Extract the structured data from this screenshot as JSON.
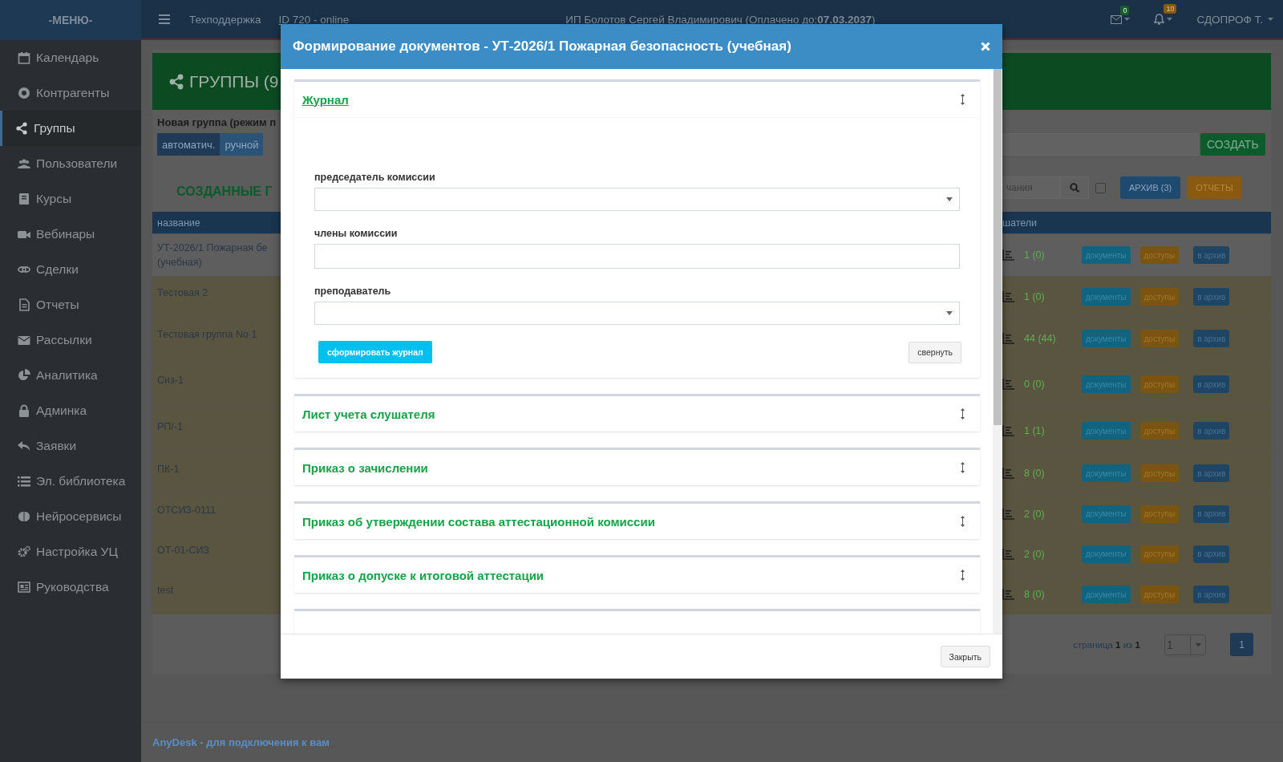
{
  "topbar": {
    "menu_title": "-МЕНЮ-",
    "support": "Техподдержка",
    "session": "ID 720 - online",
    "account": "ИП Болотов Сергей Владимирович (Оплачено до:**07.03.2037**)",
    "mail_count": "0",
    "notification_count": "10",
    "user": "СДОПРОФ Т."
  },
  "sidebar": {
    "items": [
      {
        "label": "Календарь",
        "selected": false
      },
      {
        "label": "Контрагенты",
        "selected": false
      },
      {
        "label": "Группы",
        "selected": true
      },
      {
        "label": "Пользователи",
        "selected": false
      },
      {
        "label": "Курсы",
        "selected": false
      },
      {
        "label": "Вебинары",
        "selected": false
      },
      {
        "label": "Сделки",
        "selected": false
      },
      {
        "label": "Отчеты",
        "selected": false
      },
      {
        "label": "Рассылки",
        "selected": false
      },
      {
        "label": "Аналитика",
        "selected": false
      },
      {
        "label": "Админка",
        "selected": false
      },
      {
        "label": "Заявки",
        "selected": false
      },
      {
        "label": "Эл. библиотека",
        "selected": false
      },
      {
        "label": "Нейросервисы",
        "selected": false
      },
      {
        "label": "Настройка УЦ",
        "selected": false
      },
      {
        "label": "Руководства",
        "selected": false
      }
    ]
  },
  "groups": {
    "title": "ГРУППЫ (9",
    "new_group_label": "Новая группа (режим п",
    "modes": [
      {
        "label": "автоматич.",
        "selected": true
      },
      {
        "label": "ручной",
        "selected": false
      }
    ],
    "create_button": "СОЗДАТЬ",
    "list_title": "СОЗДАННЫЕ Г",
    "search": {
      "placeholder": "чания"
    },
    "show_archived": {
      "checked": false
    },
    "archive_button": "АРХИВ (3)",
    "reports_button": "ОТЧЕТЫ",
    "table": {
      "columns": [
        "название",
        "шатели"
      ],
      "rows": [
        {
          "name": "УТ-2026/1 Пожарная бе",
          "name_continued": "(учебная)",
          "highlighted": false,
          "count": "1 (0)",
          "documents_button": "документы",
          "access_button": "доступы",
          "archive_button": "в архив"
        },
        {
          "name": "Тестовая 2",
          "highlighted": true,
          "count": "1 (0)",
          "documents_button": "документы",
          "access_button": "доступы",
          "archive_button": "в архив"
        },
        {
          "name": "Тестовая группа No 1",
          "highlighted": true,
          "count": "44 (44)",
          "documents_button": "документы",
          "access_button": "доступы",
          "archive_button": "в архив"
        },
        {
          "name": "Сиз-1",
          "highlighted": true,
          "count": "0 (0)",
          "documents_button": "документы",
          "access_button": "доступы",
          "archive_button": "в архив"
        },
        {
          "name": "РП/-1",
          "highlighted": true,
          "count": "1 (1)",
          "documents_button": "документы",
          "access_button": "доступы",
          "archive_button": "в архив"
        },
        {
          "name": "ПК-1",
          "highlighted": true,
          "count": "8 (0)",
          "documents_button": "документы",
          "access_button": "доступы",
          "archive_button": "в архив"
        },
        {
          "name": "ОТСИЗ-0111",
          "highlighted": true,
          "count": "2 (0)",
          "documents_button": "документы",
          "access_button": "доступы",
          "archive_button": "в архив"
        },
        {
          "name": "ОТ-01-СИЗ",
          "highlighted": true,
          "count": "2 (0)",
          "documents_button": "документы",
          "access_button": "доступы",
          "archive_button": "в архив"
        },
        {
          "name": "test",
          "highlighted": true,
          "count": "8 (0)",
          "documents_button": "документы",
          "access_button": "доступы",
          "archive_button": "в архив"
        }
      ]
    },
    "pagination": {
      "label": "страница **1** из **1**",
      "page_select": "1",
      "pages": [
        {
          "label": "1",
          "selected": true
        }
      ]
    }
  },
  "modal": {
    "title": "Формирование документов - УТ-2026/1 Пожарная безопасность (учебная)",
    "sections": [
      {
        "title": "Журнал",
        "expanded": true,
        "fields": [
          {
            "label": "председатель комиссии",
            "kind": "select"
          },
          {
            "label": "члены комиссии",
            "kind": "input"
          },
          {
            "label": "преподаватель",
            "kind": "select"
          }
        ],
        "submit_button": "сформировать журнал",
        "collapse_button": "свернуть"
      },
      {
        "title": "Лист учета слушателя",
        "expanded": false
      },
      {
        "title": "Приказ о зачислении",
        "expanded": false
      },
      {
        "title": "Приказ об утверждении состава аттестационной комиссии",
        "expanded": false
      },
      {
        "title": "Приказ о допуске к итоговой аттестации",
        "expanded": false
      },
      {
        "expanded": false
      }
    ],
    "close_button": "Закрыть"
  },
  "footer": {
    "text": "AnyDesk - для подключения к вам"
  }
}
